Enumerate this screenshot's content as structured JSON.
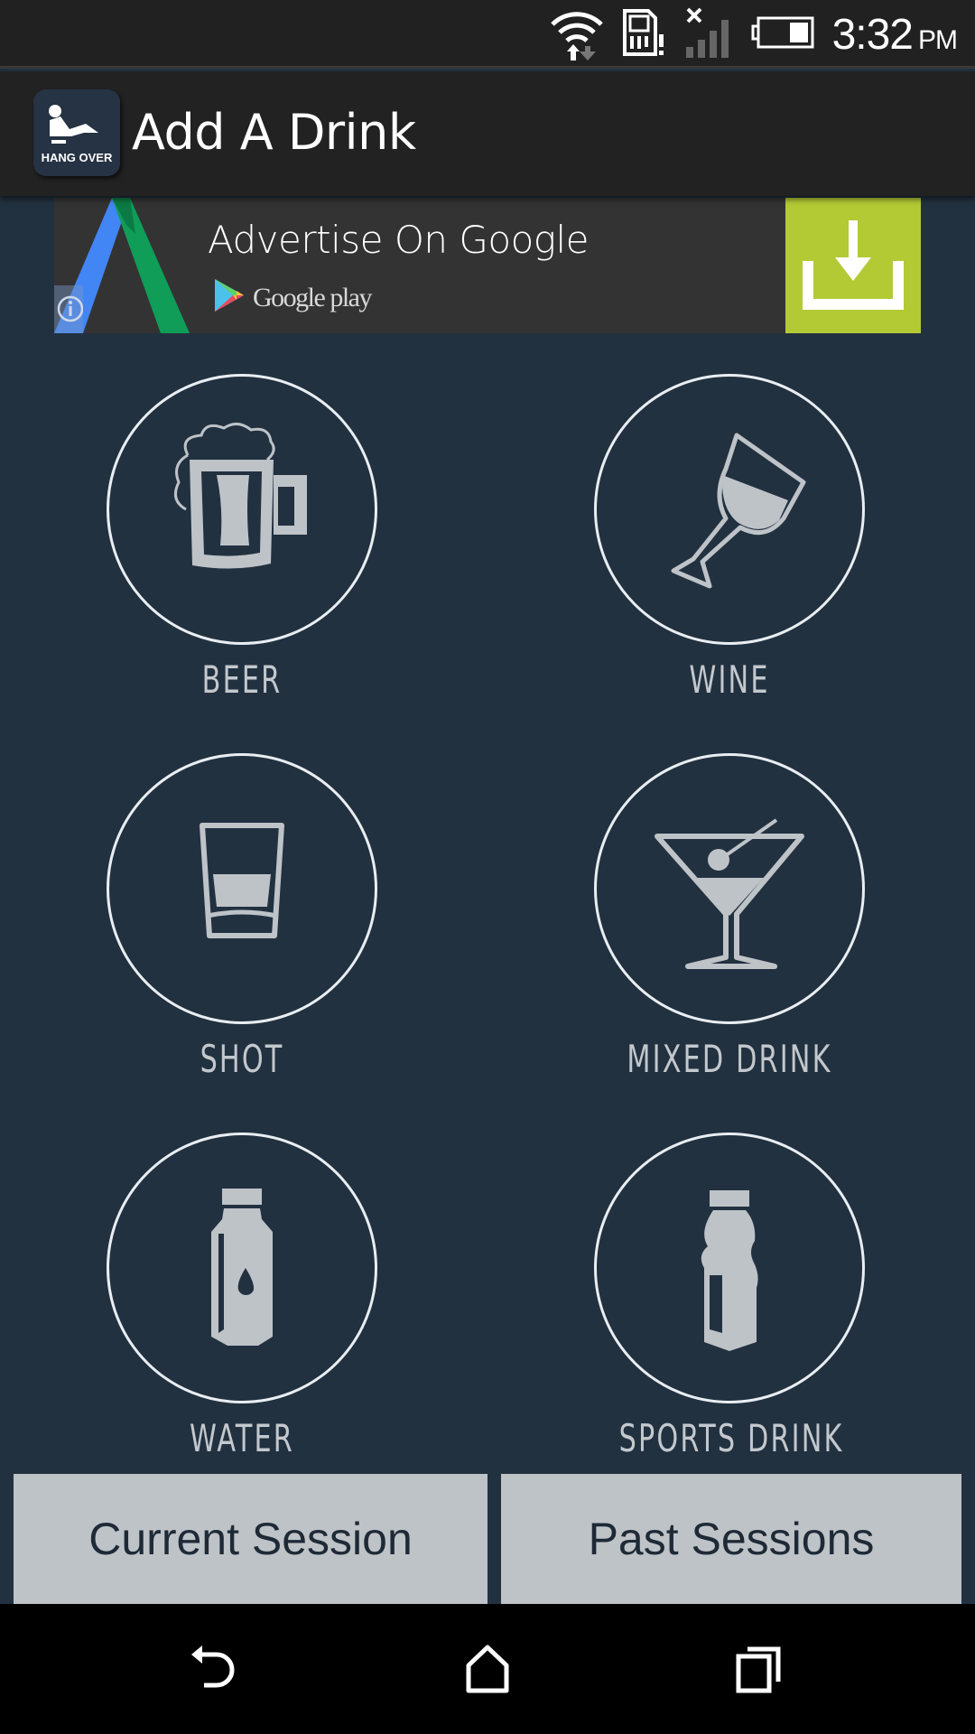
{
  "status_bar": {
    "time": "3:32",
    "ampm": "PM",
    "icons": [
      "wifi-data-icon",
      "sim-alert-icon",
      "signal-no-service-icon",
      "battery-icon"
    ],
    "battery_level": 0.35
  },
  "app_bar": {
    "title": "Add A Drink",
    "app_icon": "hangover-app-icon",
    "app_icon_text": "HANG OVER"
  },
  "ad": {
    "title": "Advertise On Google",
    "store_label": "Google play",
    "accent_color": "#b3ca35",
    "icons": [
      "google-ads-logo",
      "info-icon",
      "google-play-icon",
      "download-icon"
    ]
  },
  "drinks": [
    {
      "id": "beer",
      "label": "BEER",
      "icon": "beer-mug-icon"
    },
    {
      "id": "wine",
      "label": "WINE",
      "icon": "wine-glass-icon"
    },
    {
      "id": "shot",
      "label": "SHOT",
      "icon": "shot-glass-icon"
    },
    {
      "id": "mixed-drink",
      "label": "MIXED DRINK",
      "icon": "martini-icon"
    },
    {
      "id": "water",
      "label": "WATER",
      "icon": "water-bottle-icon"
    },
    {
      "id": "sports-drink",
      "label": "SPORTS DRINK",
      "icon": "sports-bottle-icon"
    }
  ],
  "bottom_buttons": {
    "current_session": "Current Session",
    "past_sessions": "Past Sessions"
  },
  "nav_bar": {
    "buttons": [
      "back",
      "home",
      "recent-apps"
    ]
  },
  "colors": {
    "background": "#223140",
    "app_bar": "#222222",
    "icon_fill": "#bec3c8",
    "button_bg": "#bec3c8",
    "button_text": "#1e2a36"
  }
}
